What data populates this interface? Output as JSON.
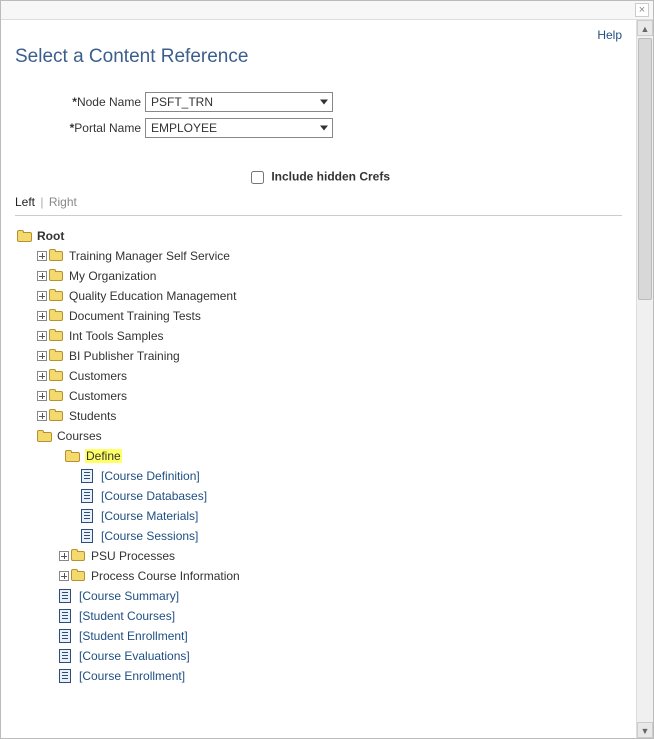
{
  "header": {
    "help_label": "Help",
    "page_title": "Select a Content Reference"
  },
  "form": {
    "node_name_label": "Node Name",
    "node_name_value": "PSFT_TRN",
    "portal_name_label": "Portal Name",
    "portal_name_value": "EMPLOYEE",
    "include_hidden_label": "Include hidden Crefs",
    "include_hidden_checked": false
  },
  "panes": {
    "left": "Left",
    "right": "Right",
    "active": "left"
  },
  "tree": {
    "root_label": "Root",
    "level1": [
      "Training Manager Self Service",
      "My Organization",
      "Quality Education Management",
      "Document Training Tests",
      "Int Tools Samples",
      "BI Publisher Training",
      "Customers",
      "Customers",
      "Students"
    ],
    "courses": {
      "label": "Courses",
      "define": {
        "label": "Define",
        "items": [
          "[Course Definition]",
          "[Course Databases]",
          "[Course Materials]",
          "[Course Sessions]"
        ]
      },
      "after_define_folders": [
        "PSU Processes",
        "Process Course Information"
      ],
      "after_define_docs": [
        "[Course Summary]",
        "[Student Courses]",
        "[Student Enrollment]",
        "[Course Evaluations]",
        "[Course Enrollment]"
      ]
    }
  }
}
